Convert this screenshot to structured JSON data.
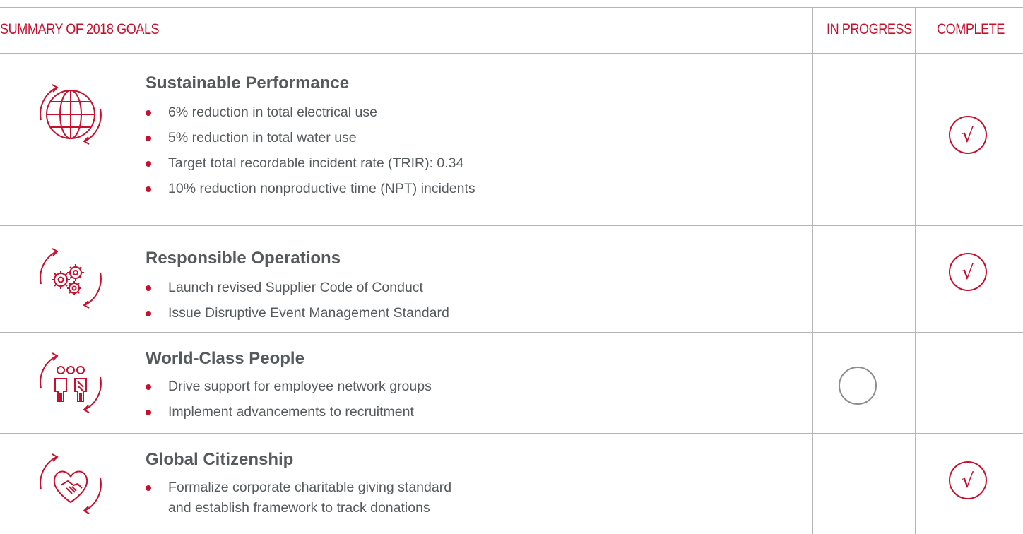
{
  "header": {
    "title": "SUMMARY OF 2018 GOALS",
    "in_progress": "IN PROGRESS",
    "complete": "COMPLETE"
  },
  "colors": {
    "accent": "#c8102e",
    "text": "#555a5d",
    "rule": "#b5b5b5",
    "pending_circle": "#8c8c8c"
  },
  "goals": [
    {
      "title": "Sustainable Performance",
      "icon": "globe-arrows-icon",
      "items": [
        "6% reduction in total electrical use",
        "5% reduction in total water use",
        "Target total recordable incident rate (TRIR): 0.34",
        "10% reduction nonproductive time (NPT) incidents"
      ],
      "status": "complete",
      "status_mark": "√"
    },
    {
      "title": "Responsible Operations",
      "icon": "gears-arrows-icon",
      "items": [
        "Launch revised Supplier Code of Conduct",
        "Issue Disruptive Event Management Standard"
      ],
      "status": "complete",
      "status_mark": "√"
    },
    {
      "title": "World-Class People",
      "icon": "people-arrows-icon",
      "items": [
        "Drive support for employee network groups",
        "Implement advancements to recruitment"
      ],
      "status": "in-progress",
      "status_mark": ""
    },
    {
      "title": "Global Citizenship",
      "icon": "heart-handshake-arrows-icon",
      "items": [
        "Formalize corporate charitable giving standard",
        "and establish framework to track donations"
      ],
      "status": "complete",
      "status_mark": "√"
    }
  ]
}
